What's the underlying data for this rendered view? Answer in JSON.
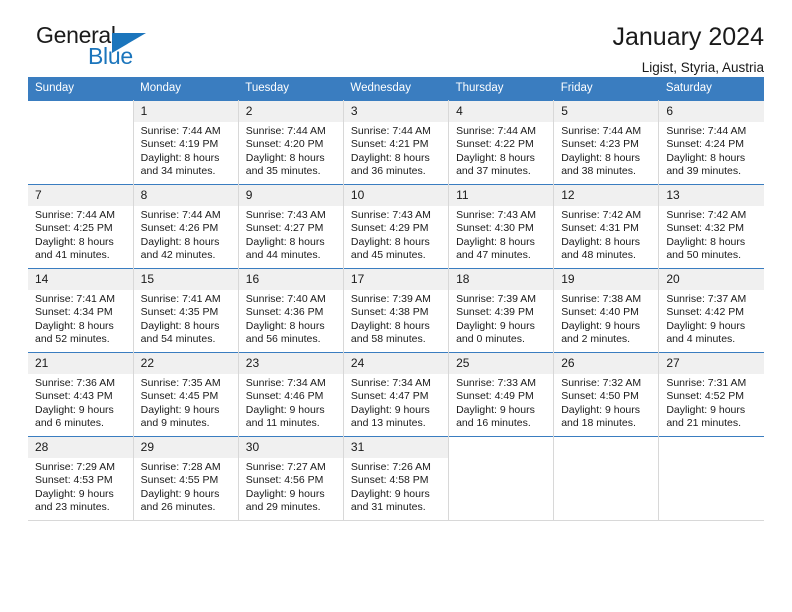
{
  "brand": {
    "name_part1": "General",
    "name_part2": "Blue",
    "logo_icon": "triangle-icon"
  },
  "header": {
    "title": "January 2024",
    "location": "Ligist, Styria, Austria"
  },
  "colors": {
    "header_blue": "#3a7dc0",
    "brand_blue": "#1b75bc",
    "daynum_bg": "#f0f0f0",
    "grid_line": "#d8d8d8"
  },
  "weekdays": [
    "Sunday",
    "Monday",
    "Tuesday",
    "Wednesday",
    "Thursday",
    "Friday",
    "Saturday"
  ],
  "weeks": [
    [
      {
        "day": "",
        "sunrise": "",
        "sunset": "",
        "daylight_1": "",
        "daylight_2": "",
        "empty": true
      },
      {
        "day": "1",
        "sunrise": "Sunrise: 7:44 AM",
        "sunset": "Sunset: 4:19 PM",
        "daylight_1": "Daylight: 8 hours",
        "daylight_2": "and 34 minutes."
      },
      {
        "day": "2",
        "sunrise": "Sunrise: 7:44 AM",
        "sunset": "Sunset: 4:20 PM",
        "daylight_1": "Daylight: 8 hours",
        "daylight_2": "and 35 minutes."
      },
      {
        "day": "3",
        "sunrise": "Sunrise: 7:44 AM",
        "sunset": "Sunset: 4:21 PM",
        "daylight_1": "Daylight: 8 hours",
        "daylight_2": "and 36 minutes."
      },
      {
        "day": "4",
        "sunrise": "Sunrise: 7:44 AM",
        "sunset": "Sunset: 4:22 PM",
        "daylight_1": "Daylight: 8 hours",
        "daylight_2": "and 37 minutes."
      },
      {
        "day": "5",
        "sunrise": "Sunrise: 7:44 AM",
        "sunset": "Sunset: 4:23 PM",
        "daylight_1": "Daylight: 8 hours",
        "daylight_2": "and 38 minutes."
      },
      {
        "day": "6",
        "sunrise": "Sunrise: 7:44 AM",
        "sunset": "Sunset: 4:24 PM",
        "daylight_1": "Daylight: 8 hours",
        "daylight_2": "and 39 minutes."
      }
    ],
    [
      {
        "day": "7",
        "sunrise": "Sunrise: 7:44 AM",
        "sunset": "Sunset: 4:25 PM",
        "daylight_1": "Daylight: 8 hours",
        "daylight_2": "and 41 minutes."
      },
      {
        "day": "8",
        "sunrise": "Sunrise: 7:44 AM",
        "sunset": "Sunset: 4:26 PM",
        "daylight_1": "Daylight: 8 hours",
        "daylight_2": "and 42 minutes."
      },
      {
        "day": "9",
        "sunrise": "Sunrise: 7:43 AM",
        "sunset": "Sunset: 4:27 PM",
        "daylight_1": "Daylight: 8 hours",
        "daylight_2": "and 44 minutes."
      },
      {
        "day": "10",
        "sunrise": "Sunrise: 7:43 AM",
        "sunset": "Sunset: 4:29 PM",
        "daylight_1": "Daylight: 8 hours",
        "daylight_2": "and 45 minutes."
      },
      {
        "day": "11",
        "sunrise": "Sunrise: 7:43 AM",
        "sunset": "Sunset: 4:30 PM",
        "daylight_1": "Daylight: 8 hours",
        "daylight_2": "and 47 minutes."
      },
      {
        "day": "12",
        "sunrise": "Sunrise: 7:42 AM",
        "sunset": "Sunset: 4:31 PM",
        "daylight_1": "Daylight: 8 hours",
        "daylight_2": "and 48 minutes."
      },
      {
        "day": "13",
        "sunrise": "Sunrise: 7:42 AM",
        "sunset": "Sunset: 4:32 PM",
        "daylight_1": "Daylight: 8 hours",
        "daylight_2": "and 50 minutes."
      }
    ],
    [
      {
        "day": "14",
        "sunrise": "Sunrise: 7:41 AM",
        "sunset": "Sunset: 4:34 PM",
        "daylight_1": "Daylight: 8 hours",
        "daylight_2": "and 52 minutes."
      },
      {
        "day": "15",
        "sunrise": "Sunrise: 7:41 AM",
        "sunset": "Sunset: 4:35 PM",
        "daylight_1": "Daylight: 8 hours",
        "daylight_2": "and 54 minutes."
      },
      {
        "day": "16",
        "sunrise": "Sunrise: 7:40 AM",
        "sunset": "Sunset: 4:36 PM",
        "daylight_1": "Daylight: 8 hours",
        "daylight_2": "and 56 minutes."
      },
      {
        "day": "17",
        "sunrise": "Sunrise: 7:39 AM",
        "sunset": "Sunset: 4:38 PM",
        "daylight_1": "Daylight: 8 hours",
        "daylight_2": "and 58 minutes."
      },
      {
        "day": "18",
        "sunrise": "Sunrise: 7:39 AM",
        "sunset": "Sunset: 4:39 PM",
        "daylight_1": "Daylight: 9 hours",
        "daylight_2": "and 0 minutes."
      },
      {
        "day": "19",
        "sunrise": "Sunrise: 7:38 AM",
        "sunset": "Sunset: 4:40 PM",
        "daylight_1": "Daylight: 9 hours",
        "daylight_2": "and 2 minutes."
      },
      {
        "day": "20",
        "sunrise": "Sunrise: 7:37 AM",
        "sunset": "Sunset: 4:42 PM",
        "daylight_1": "Daylight: 9 hours",
        "daylight_2": "and 4 minutes."
      }
    ],
    [
      {
        "day": "21",
        "sunrise": "Sunrise: 7:36 AM",
        "sunset": "Sunset: 4:43 PM",
        "daylight_1": "Daylight: 9 hours",
        "daylight_2": "and 6 minutes."
      },
      {
        "day": "22",
        "sunrise": "Sunrise: 7:35 AM",
        "sunset": "Sunset: 4:45 PM",
        "daylight_1": "Daylight: 9 hours",
        "daylight_2": "and 9 minutes."
      },
      {
        "day": "23",
        "sunrise": "Sunrise: 7:34 AM",
        "sunset": "Sunset: 4:46 PM",
        "daylight_1": "Daylight: 9 hours",
        "daylight_2": "and 11 minutes."
      },
      {
        "day": "24",
        "sunrise": "Sunrise: 7:34 AM",
        "sunset": "Sunset: 4:47 PM",
        "daylight_1": "Daylight: 9 hours",
        "daylight_2": "and 13 minutes."
      },
      {
        "day": "25",
        "sunrise": "Sunrise: 7:33 AM",
        "sunset": "Sunset: 4:49 PM",
        "daylight_1": "Daylight: 9 hours",
        "daylight_2": "and 16 minutes."
      },
      {
        "day": "26",
        "sunrise": "Sunrise: 7:32 AM",
        "sunset": "Sunset: 4:50 PM",
        "daylight_1": "Daylight: 9 hours",
        "daylight_2": "and 18 minutes."
      },
      {
        "day": "27",
        "sunrise": "Sunrise: 7:31 AM",
        "sunset": "Sunset: 4:52 PM",
        "daylight_1": "Daylight: 9 hours",
        "daylight_2": "and 21 minutes."
      }
    ],
    [
      {
        "day": "28",
        "sunrise": "Sunrise: 7:29 AM",
        "sunset": "Sunset: 4:53 PM",
        "daylight_1": "Daylight: 9 hours",
        "daylight_2": "and 23 minutes."
      },
      {
        "day": "29",
        "sunrise": "Sunrise: 7:28 AM",
        "sunset": "Sunset: 4:55 PM",
        "daylight_1": "Daylight: 9 hours",
        "daylight_2": "and 26 minutes."
      },
      {
        "day": "30",
        "sunrise": "Sunrise: 7:27 AM",
        "sunset": "Sunset: 4:56 PM",
        "daylight_1": "Daylight: 9 hours",
        "daylight_2": "and 29 minutes."
      },
      {
        "day": "31",
        "sunrise": "Sunrise: 7:26 AM",
        "sunset": "Sunset: 4:58 PM",
        "daylight_1": "Daylight: 9 hours",
        "daylight_2": "and 31 minutes."
      },
      {
        "day": "",
        "sunrise": "",
        "sunset": "",
        "daylight_1": "",
        "daylight_2": "",
        "empty": true
      },
      {
        "day": "",
        "sunrise": "",
        "sunset": "",
        "daylight_1": "",
        "daylight_2": "",
        "empty": true
      },
      {
        "day": "",
        "sunrise": "",
        "sunset": "",
        "daylight_1": "",
        "daylight_2": "",
        "empty": true
      }
    ]
  ]
}
